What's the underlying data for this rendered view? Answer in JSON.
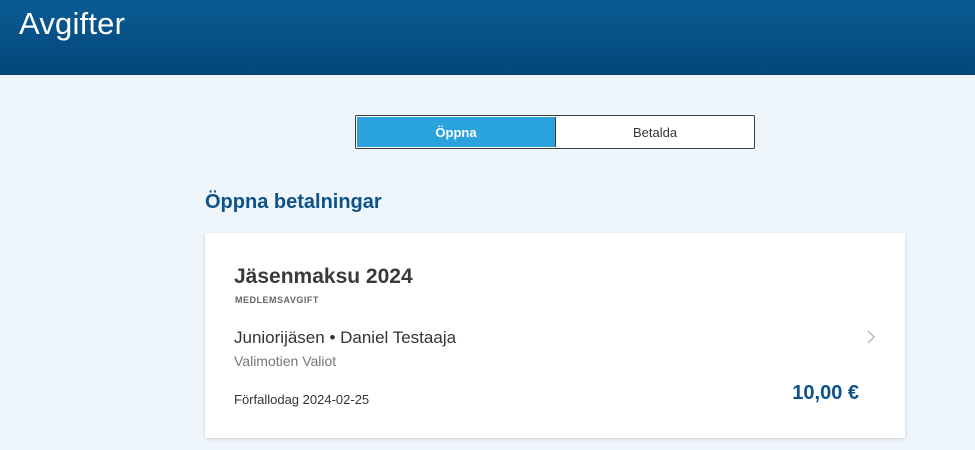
{
  "header": {
    "title": "Avgifter"
  },
  "tabs": [
    {
      "label": "Öppna",
      "active": true
    },
    {
      "label": "Betalda",
      "active": false
    }
  ],
  "section": {
    "title": "Öppna betalningar"
  },
  "payments": [
    {
      "title": "Jäsenmaksu 2024",
      "type": "MEDLEMSAVGIFT",
      "member": "Juniorijäsen • Daniel Testaaja",
      "club": "Valimotien Valiot",
      "due": "Förfallodag 2024-02-25",
      "amount": "10,00 €",
      "icon": "chevron-right-icon"
    }
  ],
  "colors": {
    "header": "#03477a",
    "accent": "#2aa3dc",
    "title": "#0d5289",
    "background": "#eef5fb"
  }
}
